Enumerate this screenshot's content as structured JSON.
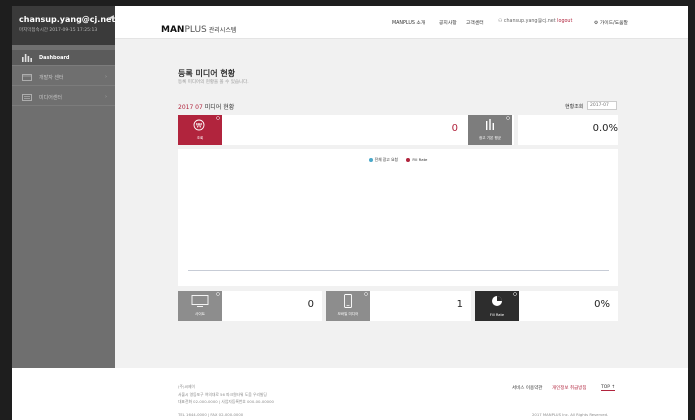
{
  "sidebar": {
    "user_email": "chansup.yang@cj.net",
    "last_login": "마지막접속시간  2017-09-15 17:25:13",
    "items": [
      {
        "label": "Dashboard",
        "icon": "bar-chart-icon"
      },
      {
        "label": "개발자 센터",
        "icon": "code-window-icon"
      },
      {
        "label": "미디어센터",
        "icon": "media-list-icon"
      }
    ]
  },
  "header": {
    "logo_main": "MAN",
    "logo_plus": "PLUS",
    "logo_sub": "관리시스템",
    "nav": [
      "MANPLUS 소개",
      "공지사항",
      "고객센터"
    ],
    "user_text": "chansup.yang@cj.net",
    "logout": "logout",
    "settings": "가이드/도움말"
  },
  "content": {
    "title": "등록 미디어 현황",
    "description": "등록 미디어의 현황을 볼 수 있습니다.",
    "stats_year": "2017 07",
    "stats_title": "미디어 현황",
    "month_label": "현황조회",
    "month_value": "2017-07",
    "top_stats": [
      {
        "label": "조회",
        "value": "0",
        "tile_color": "#b1243d",
        "icon": "won-coin-icon"
      },
      {
        "label": "광고 기본 평균",
        "value": "0.0%",
        "tile_color": "#7d7d7d",
        "icon": "usage-bars-icon"
      }
    ],
    "bottom_stats": [
      {
        "label": "사이트",
        "value": "0",
        "tile_color": "#8d8d8d",
        "icon": "monitor-icon"
      },
      {
        "label": "모바일 미디어",
        "value": "1",
        "tile_color": "#8d8d8d",
        "icon": "mobile-icon"
      },
      {
        "label": "Fill Rate",
        "value": "0%",
        "tile_color": "#2d2d2d",
        "icon": "pie-chart-icon"
      }
    ]
  },
  "chart": {
    "legend": [
      {
        "name": "전체 광고 요청",
        "color": "#4aa8c9"
      },
      {
        "name": "Fill Rate",
        "color": "#b1243d"
      }
    ]
  },
  "footer": {
    "company": "(주)씨제이",
    "address_1": "서울시 영등포구 여의대로 56 파크원타워 도움 우리빌딩",
    "address_2": "대표전화 02-000-0000 | 사업자등록번호 000-00-00000",
    "biz_no": "TEL 1644-0000 | FAX 02-000-0000",
    "terms": "서비스 이용약관",
    "privacy": "개인정보 취급방침",
    "top": "TOP",
    "copyright": "2017 MANPLUS Inc. All Rights Reserved."
  }
}
